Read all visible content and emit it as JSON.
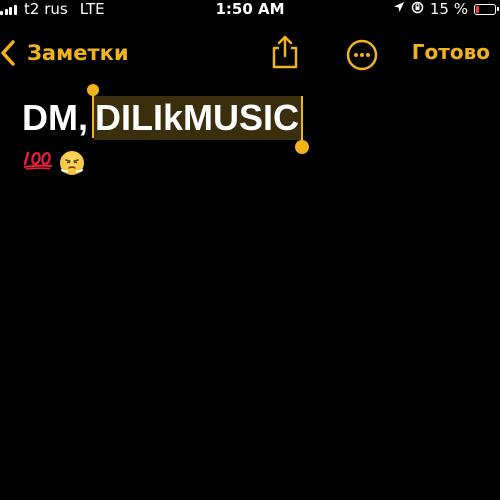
{
  "status_bar": {
    "carrier": "t2 rus",
    "network": "LTE",
    "time": "1:50 AM",
    "battery_percent": "15 %",
    "battery_level": 0.15,
    "icons": [
      "signal-bars-icon",
      "location-icon",
      "orientation-lock-icon",
      "battery-icon"
    ]
  },
  "nav": {
    "back_label": "Заметки",
    "done_label": "Готово",
    "icons": [
      "chevron-left-icon",
      "share-icon",
      "more-icon"
    ]
  },
  "note": {
    "title_plain": "DM,",
    "title_selected": "DILIkMUSIC",
    "emoji_100": "💯",
    "emoji_face": "😤"
  },
  "colors": {
    "accent": "#f0b31b",
    "background": "#000000",
    "text": "#ffffff",
    "selection": "#3a2e0c",
    "battery_low": "#ff3b30"
  }
}
